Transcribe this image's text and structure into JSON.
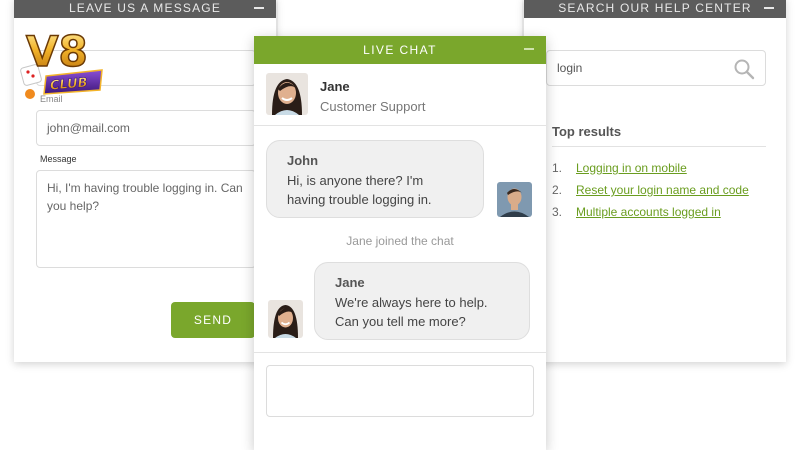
{
  "left_panel": {
    "title": "LEAVE US A MESSAGE",
    "name_field_value": "",
    "email_label": "Email",
    "email_value": "john@mail.com",
    "message_label": "Message",
    "message_value": "Hi, I'm having trouble logging in. Can you help?",
    "send_label": "SEND"
  },
  "right_panel": {
    "title": "SEARCH OUR HELP CENTER",
    "search_value": "login",
    "results_heading": "Top results",
    "results": [
      {
        "num": "1.",
        "label": "Logging in on mobile"
      },
      {
        "num": "2.",
        "label": "Reset your login name and code"
      },
      {
        "num": "3.",
        "label": "Multiple accounts logged in"
      }
    ]
  },
  "chat": {
    "title": "LIVE CHAT",
    "agent_name": "Jane",
    "agent_role": "Customer Support",
    "messages": [
      {
        "sender": "John",
        "text": "Hi, is anyone there? I'm having trouble logging in."
      },
      {
        "sender": "Jane",
        "text": "We're always here to help. Can you tell me more?"
      }
    ],
    "system_message": "Jane joined the chat",
    "input_value": ""
  },
  "logo": {
    "text": "V8",
    "subtext": "CLUB"
  },
  "colors": {
    "accent": "#7aa72c",
    "panel_header": "#5c5c5c",
    "link": "#6a9d1f",
    "logo_gold": "#e8a61c"
  }
}
